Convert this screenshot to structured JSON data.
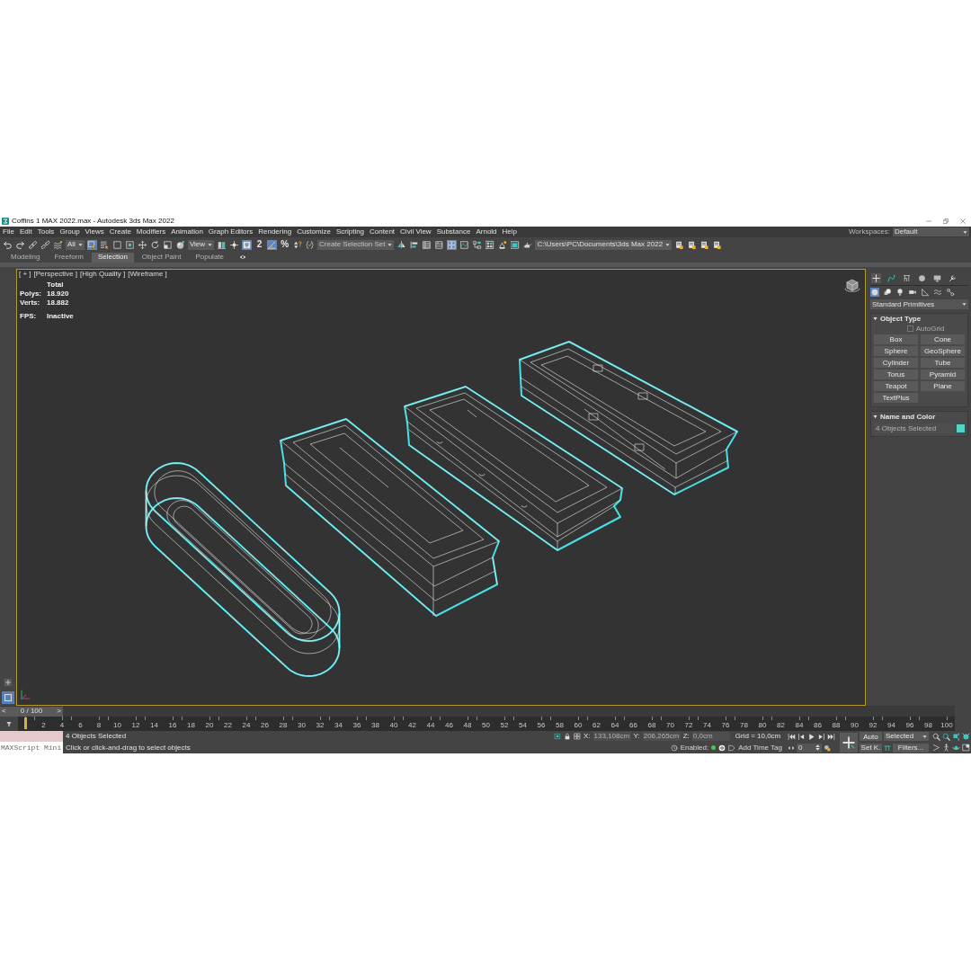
{
  "window": {
    "title": "Coffins 1 MAX 2022.max - Autodesk 3ds Max 2022"
  },
  "menu_bar": {
    "items": [
      "File",
      "Edit",
      "Tools",
      "Group",
      "Views",
      "Create",
      "Modifiers",
      "Animation",
      "Graph Editors",
      "Rendering",
      "Customize",
      "Scripting",
      "Content",
      "Civil View",
      "Substance",
      "Arnold",
      "Help"
    ],
    "workspaces": {
      "label": "Workspaces:",
      "value": "Default"
    }
  },
  "main_toolbar": {
    "items": [
      {
        "kind": "undo",
        "active": false
      },
      {
        "kind": "redo",
        "active": false
      },
      {
        "kind": "link",
        "active": false
      },
      {
        "kind": "unlink",
        "active": false
      },
      {
        "kind": "bind",
        "active": false
      },
      {
        "kind": "filter",
        "value": "All"
      },
      {
        "kind": "select",
        "active": true
      },
      {
        "kind": "byname",
        "active": false
      },
      {
        "kind": "region",
        "active": false
      },
      {
        "kind": "crossing",
        "active": false
      },
      {
        "kind": "move",
        "active": false
      },
      {
        "kind": "rotate",
        "active": false
      },
      {
        "kind": "scale",
        "active": false
      },
      {
        "kind": "place",
        "active": false
      },
      {
        "kind": "coordsys",
        "value": "View"
      },
      {
        "kind": "pivot",
        "active": false
      },
      {
        "kind": "manipulate",
        "active": false
      },
      {
        "kind": "override",
        "active": true
      },
      {
        "kind": "snap",
        "glyph": "2",
        "active": false
      },
      {
        "kind": "angle",
        "active": true
      },
      {
        "kind": "percent",
        "glyph": "%",
        "active": false
      },
      {
        "kind": "spinner",
        "active": false
      },
      {
        "kind": "braces",
        "active": false
      },
      {
        "kind": "selset",
        "placeholder": "Create Selection Set"
      },
      {
        "kind": "mirror",
        "active": false
      },
      {
        "kind": "align",
        "active": false
      },
      {
        "kind": "explorer",
        "active": false
      },
      {
        "kind": "layers",
        "active": false
      },
      {
        "kind": "ribbon",
        "active": true
      },
      {
        "kind": "curves",
        "active": false
      },
      {
        "kind": "schematic",
        "active": false
      },
      {
        "kind": "material",
        "active": false
      },
      {
        "kind": "setup",
        "active": false
      },
      {
        "kind": "frame",
        "active": false
      },
      {
        "kind": "teapot",
        "active": false
      },
      {
        "kind": "project",
        "value": "C:\\Users\\PC\\Documents\\3ds Max 2022"
      },
      {
        "kind": "folder",
        "active": false
      },
      {
        "kind": "folder",
        "active": false
      },
      {
        "kind": "folder",
        "active": false
      },
      {
        "kind": "folder",
        "active": false
      }
    ]
  },
  "ribbon": {
    "tabs": [
      {
        "label": "Modeling",
        "selected": false
      },
      {
        "label": "Freeform",
        "selected": false
      },
      {
        "label": "Selection",
        "selected": true
      },
      {
        "label": "Object Paint",
        "selected": false
      },
      {
        "label": "Populate",
        "selected": false
      }
    ]
  },
  "left_toolbar": [
    {
      "kind": "add",
      "selected": false
    },
    {
      "kind": "layout",
      "selected": true
    }
  ],
  "viewport": {
    "active": true,
    "labels": [
      "[ + ]",
      "[Perspective ]",
      "[High Quality ]",
      "[Wireframe ]"
    ],
    "stats": {
      "header": "Total",
      "rows": [
        {
          "label": "Polys:",
          "value": "18.920"
        },
        {
          "label": "Verts:",
          "value": "18.882"
        }
      ],
      "fps": {
        "label": "FPS:",
        "value": "Inactive"
      }
    }
  },
  "command_panel": {
    "tabs": [
      {
        "kind": "create",
        "selected": true
      },
      {
        "kind": "modify",
        "selected": false
      },
      {
        "kind": "hierarchy",
        "selected": false
      },
      {
        "kind": "motion",
        "selected": false
      },
      {
        "kind": "display",
        "selected": false
      },
      {
        "kind": "utilities",
        "selected": false
      }
    ],
    "categories": [
      {
        "kind": "geometry",
        "selected": true
      },
      {
        "kind": "shapes",
        "selected": false
      },
      {
        "kind": "lights",
        "selected": false
      },
      {
        "kind": "cameras",
        "selected": false
      },
      {
        "kind": "helpers",
        "selected": false
      },
      {
        "kind": "warps",
        "selected": false
      },
      {
        "kind": "systems",
        "selected": false
      }
    ],
    "dropdown": "Standard Primitives",
    "rollouts": [
      {
        "kind": "object_type",
        "title": "Object Type",
        "expanded": true,
        "autogrid": {
          "label": "AutoGrid",
          "checked": false,
          "disabled": true
        },
        "buttons": [
          "Box",
          "Cone",
          "Sphere",
          "GeoSphere",
          "Cylinder",
          "Tube",
          "Torus",
          "Pyramid",
          "Teapot",
          "Plane",
          "TextPlus"
        ]
      },
      {
        "kind": "name_color",
        "title": "Name and Color",
        "expanded": true,
        "name": {
          "value": "4 Objects Selected",
          "disabled": true
        },
        "color": "#4fd6c4"
      }
    ]
  },
  "time_slider": {
    "prev": "<",
    "label": "0 / 100",
    "next": ">",
    "level": 0
  },
  "trackbar": {
    "labels": [
      "2",
      "4",
      "6",
      "8",
      "10",
      "12",
      "14",
      "16",
      "18",
      "20",
      "22",
      "24",
      "26",
      "28",
      "30",
      "32",
      "34",
      "36",
      "38",
      "40",
      "42",
      "44",
      "46",
      "48",
      "50",
      "52",
      "54",
      "56",
      "58",
      "60",
      "62",
      "64",
      "66",
      "68",
      "70",
      "72",
      "74",
      "76",
      "78",
      "80",
      "82",
      "84",
      "86",
      "88",
      "90",
      "92",
      "94",
      "96",
      "98",
      "100"
    ]
  },
  "status_bar": {
    "listener": {
      "placeholder": "MAXScript Mini"
    },
    "messages": [
      "4 Objects Selected",
      "Click or click-and-drag to select objects"
    ],
    "tools": [
      {
        "kind": "isolate"
      },
      {
        "kind": "lock"
      },
      {
        "kind": "transform"
      }
    ],
    "coordinates": {
      "disabled": true,
      "fields": [
        {
          "axis": "X:",
          "value": "133,108cm"
        },
        {
          "axis": "Y:",
          "value": "206,265cm"
        },
        {
          "axis": "Z:",
          "value": "0,0cm"
        }
      ]
    },
    "grid": "Grid = 10,0cm",
    "time_tag": {
      "label": "Enabled:",
      "enabled": true,
      "add": "Add Time Tag"
    },
    "playback": [
      {
        "kind": "start"
      },
      {
        "kind": "prev"
      },
      {
        "kind": "play"
      },
      {
        "kind": "next"
      },
      {
        "kind": "end"
      }
    ],
    "frame": "0",
    "set_key": {
      "auto": "Auto",
      "auto_on": false,
      "mode": "Selected",
      "set": "Set K.",
      "filters": "Filters..."
    },
    "navigation": [
      {
        "kind": "zoom"
      },
      {
        "kind": "zoomall"
      },
      {
        "kind": "extents"
      },
      {
        "kind": "extentsall"
      },
      {
        "kind": "fov"
      },
      {
        "kind": "walk"
      },
      {
        "kind": "orbit"
      },
      {
        "kind": "maximize"
      }
    ]
  }
}
